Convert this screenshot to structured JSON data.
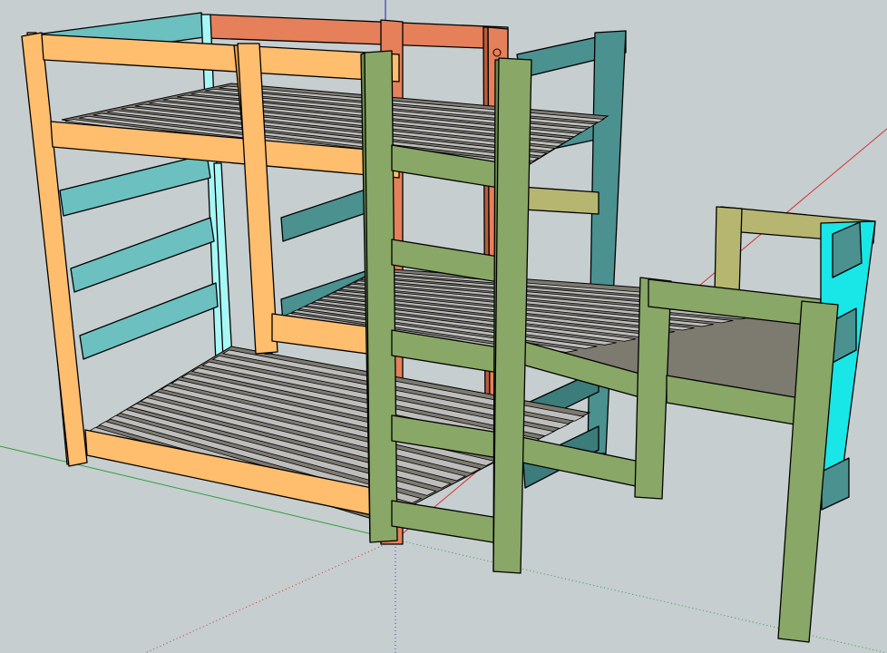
{
  "viewport": {
    "background": "#c6ced0",
    "axis_colors": {
      "x": "#d23030",
      "y": "#2f9e3a",
      "z": "#3340c8"
    }
  },
  "model": {
    "colors": {
      "front_frame": "#ffbd6e",
      "front_frame_shade": "#e69a48",
      "back_frame": "#e5805a",
      "left_frame": "#6cc0bf",
      "left_frame_light": "#a8f7f7",
      "right_frame": "#4a9190",
      "right_frame_dark": "#3c7c7b",
      "ladder_frame": "#89a766",
      "ladder_frame_dark": "#6a8a4c",
      "low_bed_frame": "#b7b671",
      "end_panel": "#19e6e6",
      "slat": "#bdbdbd",
      "slat_shade": "#7d7a70"
    }
  }
}
